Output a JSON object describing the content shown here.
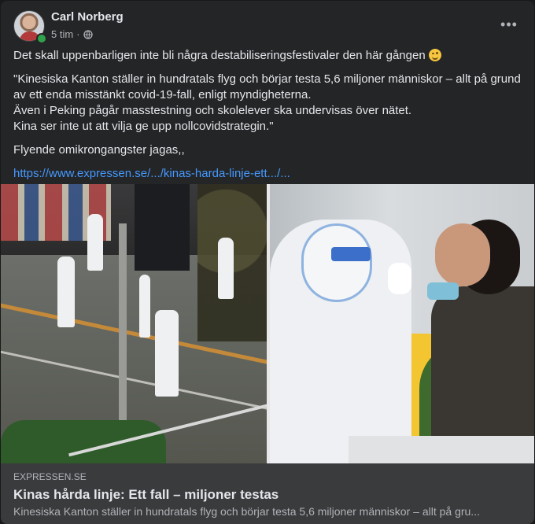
{
  "post": {
    "author": "Carl Norberg",
    "time": "5 tim",
    "separator": "·",
    "privacy_icon": "globe-icon",
    "more_icon": "more-horizontal-icon",
    "more_label": "•••",
    "text": {
      "line1": "Det skall uppenbarligen inte bli några destabiliseringsfestivaler den här gången",
      "emoji": "smirk-emoji",
      "quote": [
        "\"Kinesiska Kanton ställer in hundratals flyg och börjar testa 5,6 miljoner människor – allt på grund av ett enda misstänkt covid-19-fall, enligt myndigheterna.",
        "Även i Peking pågår masstestning och skolelever ska undervisas över nätet.",
        "Kina ser inte ut att vilja ge upp nollcovidstrategin.\""
      ],
      "line3": "Flyende omikrongangster jagas,,",
      "link": "https://www.expressen.se/.../kinas-harda-linje-ett.../..."
    }
  },
  "link_preview": {
    "source": "EXPRESSEN.SE",
    "title": "Kinas hårda linje: Ett fall – miljoner testas",
    "description": "Kinesiska Kanton ställer in hundratals flyg och börjar testa 5,6 miljoner människor – allt på gru..."
  },
  "colors": {
    "background": "#18191a",
    "card": "#242526",
    "caption": "#3a3b3c",
    "link": "#4599ff",
    "online": "#31a24c"
  }
}
